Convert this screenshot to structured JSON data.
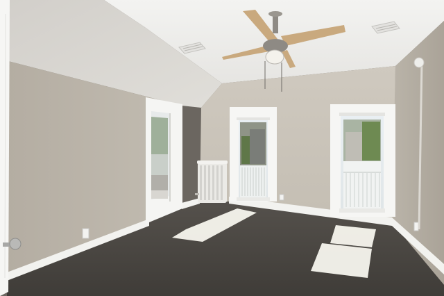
{
  "scene": {
    "kind": "empty-bedroom-interior",
    "colors": {
      "ceiling": "#eeeeec",
      "sloped_ceiling": "#d9d7d2",
      "wall_back": "#c9c3b8",
      "wall_left": "#bdb6ab",
      "wall_right": "#b5afa4",
      "carpet": "#4a4743",
      "trim": "#f4f4f2",
      "fan_blade": "#c9a97e",
      "fan_metal": "#8e8a84",
      "radiator": "#e9e8e4",
      "sunlight": "#f7f5ee",
      "sky": "#e8eef2",
      "foliage": "#6f8a55"
    },
    "objects": [
      "ceiling-fan",
      "left-window",
      "right-window",
      "open-doorway",
      "radiator",
      "interior-door-edge",
      "door-knob",
      "ceiling-vent-left",
      "ceiling-vent-right",
      "electrical-outlet",
      "sunlight-patch"
    ]
  }
}
